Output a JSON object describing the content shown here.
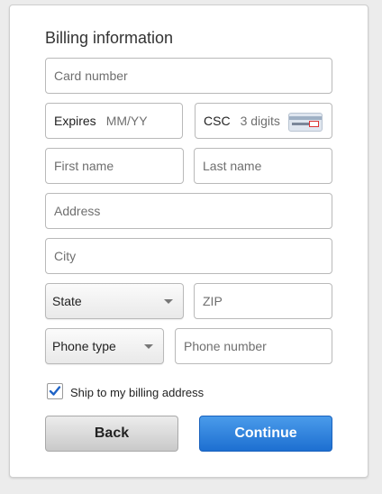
{
  "form": {
    "title": "Billing information",
    "card_number_placeholder": "Card number",
    "expires_label": "Expires",
    "expires_placeholder": "MM/YY",
    "csc_label": "CSC",
    "csc_placeholder": "3 digits",
    "first_name_placeholder": "First name",
    "last_name_placeholder": "Last name",
    "address_placeholder": "Address",
    "city_placeholder": "City",
    "state_selected": "State",
    "zip_placeholder": "ZIP",
    "phone_type_selected": "Phone type",
    "phone_number_placeholder": "Phone number",
    "ship_checkbox_label": "Ship to my billing address",
    "ship_checked": true,
    "back_label": "Back",
    "continue_label": "Continue"
  },
  "colors": {
    "accent": "#2a7fdb",
    "checkmark": "#1f63c6"
  }
}
